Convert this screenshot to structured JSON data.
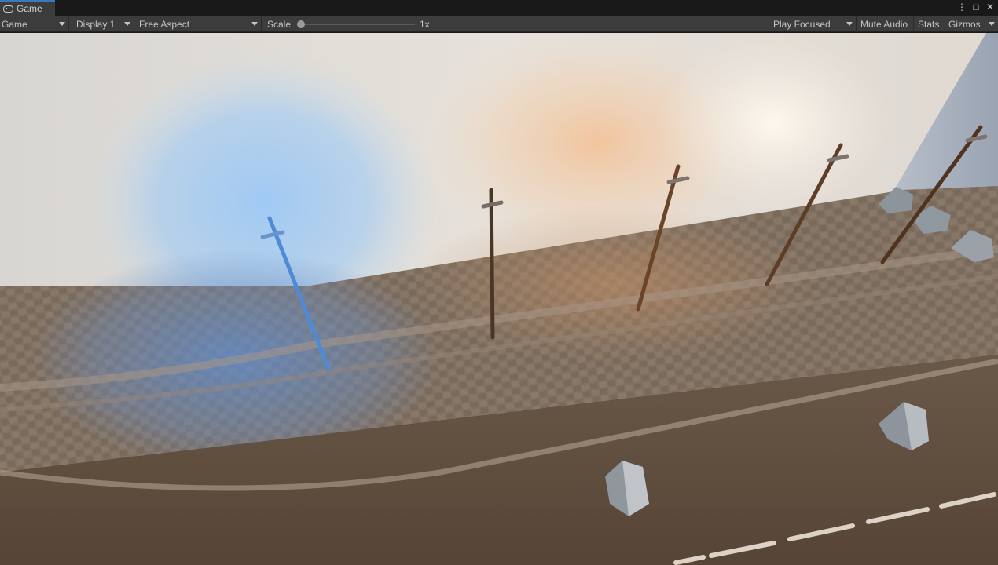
{
  "tab": {
    "label": "Game",
    "icon": "gamepad-icon"
  },
  "window_controls": [
    "⋮",
    "□",
    "✕"
  ],
  "toolbar": {
    "view_mode": "Game",
    "display": "Display 1",
    "aspect": "Free Aspect",
    "scale_label": "Scale",
    "scale_value": "1x",
    "scale_fraction": 0.0,
    "play_mode": "Play Focused",
    "mute_audio": "Mute Audio",
    "stats": "Stats",
    "gizmos": "Gizmos"
  },
  "colors": {
    "accent_tab": "#3a79bb",
    "toolbar_bg": "#3c3c3c",
    "blue_light": "#7fb6f4",
    "warm_light": "#f0b37c"
  }
}
